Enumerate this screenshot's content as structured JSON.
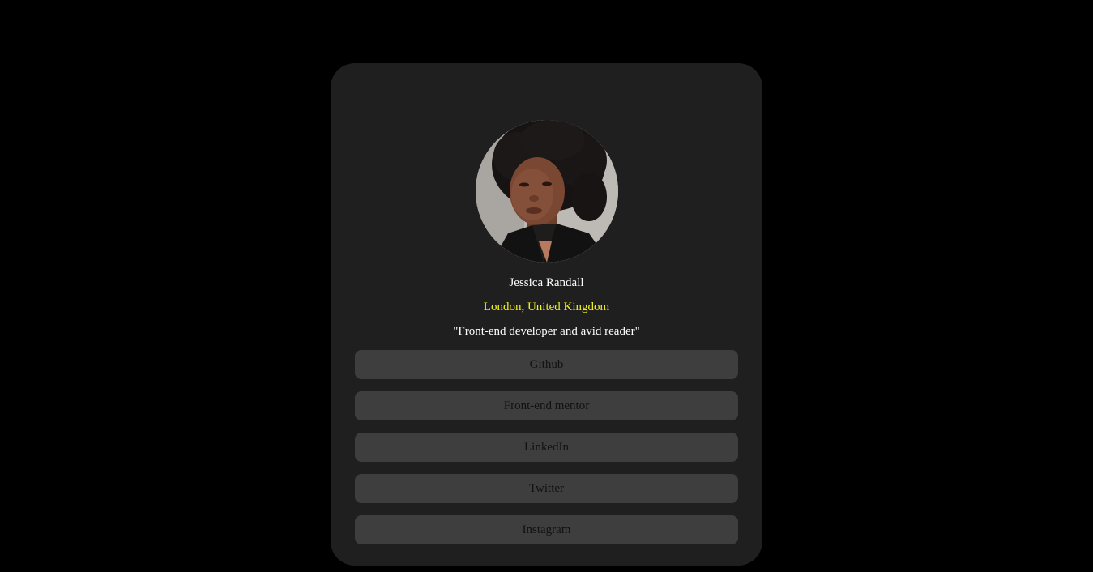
{
  "profile": {
    "name": "Jessica Randall",
    "location": "London, United Kingdom",
    "bio": "\"Front-end developer and avid reader\"",
    "avatar_icon": "profile-photo",
    "location_color": "#f2f21e"
  },
  "links": [
    {
      "label": "Github"
    },
    {
      "label": "Front-end mentor"
    },
    {
      "label": "LinkedIn"
    },
    {
      "label": "Twitter"
    },
    {
      "label": "Instagram"
    }
  ],
  "colors": {
    "background": "#000000",
    "card": "#1f1f1f",
    "button": "#3e3e3e"
  }
}
